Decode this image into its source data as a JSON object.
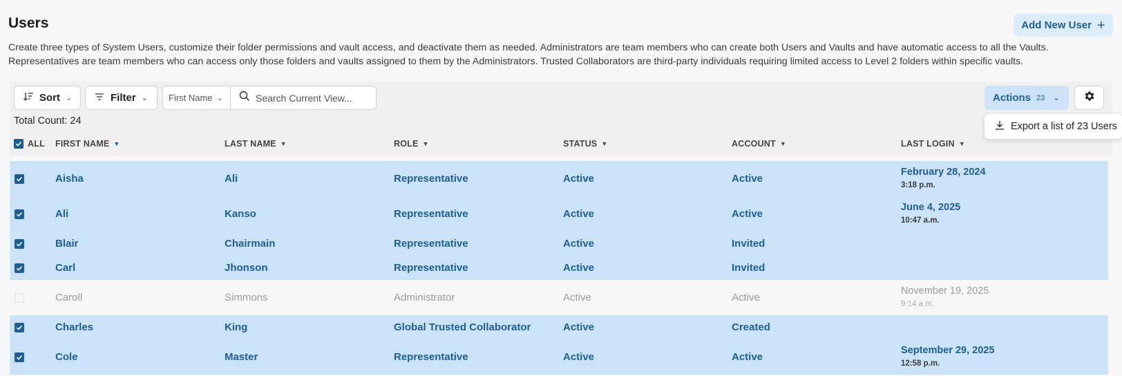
{
  "page": {
    "title": "Users",
    "add_button": "Add New User",
    "description": "Create three types of System Users, customize their folder permissions and vault access, and deactivate them as needed. Administrators are team members who can create both Users and Vaults and have automatic access to all the Vaults. Representatives are team members who can access only those folders and vaults assigned to them by the Administrators. Trusted Collaborators are third-party individuals requiring limited access to Level 2 folders within specific vaults."
  },
  "toolbar": {
    "sort_label": "Sort",
    "filter_label": "Filter",
    "field_select": "First Name",
    "search_placeholder": "Search Current View...",
    "actions_label": "Actions",
    "actions_count": "23",
    "export_item": "Export a list of 23 Users"
  },
  "total_count": "Total Count: 24",
  "columns": {
    "all": "ALL",
    "first_name": "FIRST NAME",
    "last_name": "LAST NAME",
    "role": "ROLE",
    "status": "STATUS",
    "account": "ACCOUNT",
    "last_login": "LAST LOGIN"
  },
  "rows": [
    {
      "selected": true,
      "first": "Aisha",
      "last": "Ali",
      "role": "Representative",
      "status": "Active",
      "account": "Active",
      "login_date": "February 28, 2024",
      "login_time": "3:18 p.m."
    },
    {
      "selected": true,
      "first": "Ali",
      "last": "Kanso",
      "role": "Representative",
      "status": "Active",
      "account": "Active",
      "login_date": "June 4, 2025",
      "login_time": "10:47 a.m."
    },
    {
      "selected": true,
      "first": "Blair",
      "last": "Chairmain",
      "role": "Representative",
      "status": "Active",
      "account": "Invited",
      "login_date": "",
      "login_time": ""
    },
    {
      "selected": true,
      "first": "Carl",
      "last": "Jhonson",
      "role": "Representative",
      "status": "Active",
      "account": "Invited",
      "login_date": "",
      "login_time": ""
    },
    {
      "selected": false,
      "first": "Caroll",
      "last": "Simmons",
      "role": "Administrator",
      "status": "Active",
      "account": "Active",
      "login_date": "November 19, 2025",
      "login_time": "9:14 a.m."
    },
    {
      "selected": true,
      "first": "Charles",
      "last": "King",
      "role": "Global Trusted Collaborator",
      "status": "Active",
      "account": "Created",
      "login_date": "",
      "login_time": ""
    },
    {
      "selected": true,
      "first": "Cole",
      "last": "Master",
      "role": "Representative",
      "status": "Active",
      "account": "Active",
      "login_date": "September 29, 2025",
      "login_time": "12:58 p.m."
    }
  ],
  "icons": {
    "add": "plus-icon",
    "sort": "sort-icon",
    "filter": "filter-icon",
    "search": "search-icon",
    "settings": "gear-icon",
    "download": "download-icon"
  },
  "colors": {
    "accent": "#1f5e92",
    "selected_row": "#cbe3f9",
    "actions_bg": "#cde3f8"
  }
}
